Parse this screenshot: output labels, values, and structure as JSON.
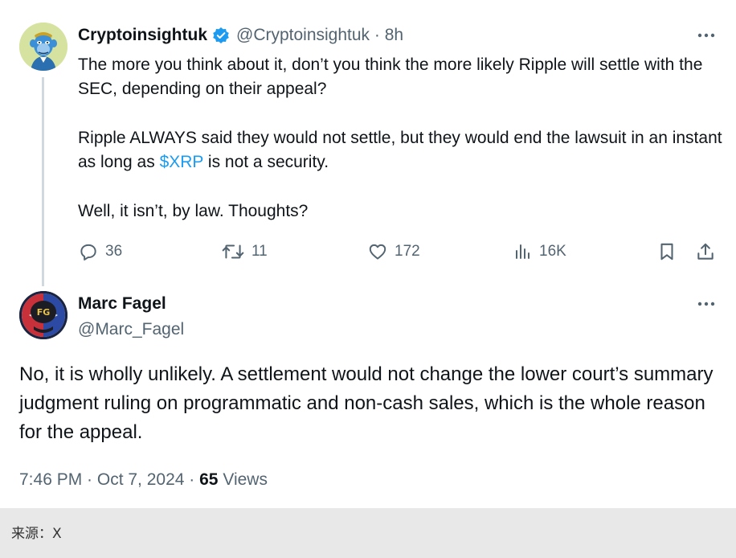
{
  "colors": {
    "text": "#0f1419",
    "secondary": "#536471",
    "link": "#1d9bf0",
    "verified_badge": "#1d9bf0",
    "caption_bg": "#e8e8e8"
  },
  "parent_tweet": {
    "display_name": "Cryptoinsightuk",
    "handle": "@Cryptoinsightuk",
    "separator": "·",
    "time": "8h",
    "verified": true,
    "more_icon": "more-horizontal-icon",
    "body_paragraph_1": "The more you think about it, don’t you think the more likely Ripple will settle with the SEC, depending on their appeal?",
    "body_paragraph_2_before": "Ripple ALWAYS said they would not settle, but they would end the lawsuit in an instant as long as ",
    "cashtag": "$XRP",
    "body_paragraph_2_after": " is not a security.",
    "body_paragraph_3": "Well, it isn’t, by law. Thoughts?",
    "actions": {
      "replies": "36",
      "reposts": "11",
      "likes": "172",
      "views": "16K"
    }
  },
  "reply_tweet": {
    "display_name": "Marc Fagel",
    "handle": "@Marc_Fagel",
    "more_icon": "more-horizontal-icon",
    "body": "No, it is wholly unlikely. A settlement would not change the lower court’s summary judgment ruling on programmatic and non-cash sales, which is the whole reason for the appeal.",
    "timestamp": "7:46 PM · Oct 7, 2024",
    "separator": "·",
    "views_count": "65",
    "views_label": "Views"
  },
  "caption": "来源：X"
}
